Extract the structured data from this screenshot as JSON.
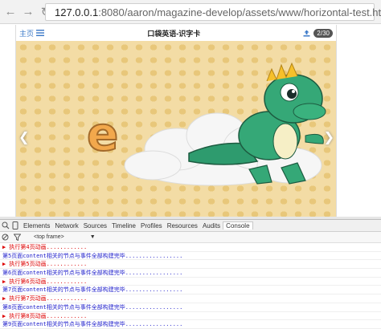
{
  "browser": {
    "back_icon": "arrow-left-icon",
    "forward_icon": "arrow-right-icon",
    "reload_icon": "reload-icon",
    "url_host": "127.0.0.1",
    "url_rest": ":8080/aaron/magazine-develop/assets/www/horizontal-test.html"
  },
  "app": {
    "home_label": "主页",
    "title": "口袋英语-识字卡",
    "page_count": "2/30"
  },
  "slide": {
    "letter": "e",
    "prev_icon": "chevron-left-icon",
    "next_icon": "chevron-right-icon"
  },
  "devtools": {
    "tabs": [
      "Elements",
      "Network",
      "Sources",
      "Timeline",
      "Profiles",
      "Resources",
      "Audits",
      "Console"
    ],
    "frame_select": "<top frame>"
  },
  "console_lines": [
    {
      "text": "▶ 执行第4页动画............",
      "type": "red"
    },
    {
      "text": "第5页面content相关的节点与事件全部构建完毕.................",
      "type": "blue"
    },
    {
      "text": "▶ 执行第5页动画............",
      "type": "red"
    },
    {
      "text": "第6页面content相关的节点与事件全部构建完毕.................",
      "type": "blue"
    },
    {
      "text": "▶ 执行第6页动画............",
      "type": "red"
    },
    {
      "text": "第7页面content相关的节点与事件全部构建完毕.................",
      "type": "blue"
    },
    {
      "text": "▶ 执行第7页动画............",
      "type": "red"
    },
    {
      "text": "第8页面content相关的节点与事件全部构建完毕.................",
      "type": "blue"
    },
    {
      "text": "▶ 执行第8页动画............",
      "type": "red"
    },
    {
      "text": "第9页面content相关的节点与事件全部构建完毕.................",
      "type": "blue"
    }
  ]
}
